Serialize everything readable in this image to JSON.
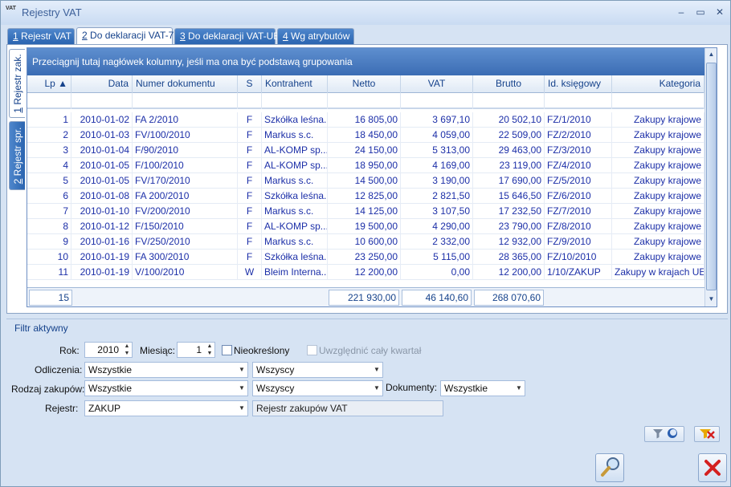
{
  "window": {
    "title": "Rejestry VAT",
    "app_icon_text": "VAT",
    "minimize": "–",
    "maximize": "▭",
    "close": "✕"
  },
  "tabs": [
    {
      "key": "1",
      "label": " Rejestr VAT"
    },
    {
      "key": "2",
      "label": " Do deklaracji VAT-7"
    },
    {
      "key": "3",
      "label": " Do deklaracji VAT-UE"
    },
    {
      "key": "4",
      "label": " Wg atrybutów"
    }
  ],
  "side_tabs": [
    {
      "key": "1",
      "label": " Rejestr zak."
    },
    {
      "key": "2",
      "label": " Rejestr spr."
    }
  ],
  "grid": {
    "group_hint": "Przeciągnij tutaj nagłówek kolumny, jeśli ma ona być podstawą grupowania",
    "columns": [
      "Lp ▲",
      "Data",
      "Numer dokumentu",
      "S",
      "Kontrahent",
      "Netto",
      "VAT",
      "Brutto",
      "Id. księgowy",
      "Kategoria"
    ],
    "rows": [
      [
        "1",
        "2010-01-02",
        "FA 2/2010",
        "F",
        "Szkółka leśna...",
        "16 805,00",
        "3 697,10",
        "20 502,10",
        "FZ/1/2010",
        "Zakupy krajowe"
      ],
      [
        "2",
        "2010-01-03",
        "FV/100/2010",
        "F",
        "Markus s.c.",
        "18 450,00",
        "4 059,00",
        "22 509,00",
        "FZ/2/2010",
        "Zakupy krajowe"
      ],
      [
        "3",
        "2010-01-04",
        "F/90/2010",
        "F",
        "AL-KOMP sp....",
        "24 150,00",
        "5 313,00",
        "29 463,00",
        "FZ/3/2010",
        "Zakupy krajowe"
      ],
      [
        "4",
        "2010-01-05",
        "F/100/2010",
        "F",
        "AL-KOMP sp....",
        "18 950,00",
        "4 169,00",
        "23 119,00",
        "FZ/4/2010",
        "Zakupy krajowe"
      ],
      [
        "5",
        "2010-01-05",
        "FV/170/2010",
        "F",
        "Markus s.c.",
        "14 500,00",
        "3 190,00",
        "17 690,00",
        "FZ/5/2010",
        "Zakupy krajowe"
      ],
      [
        "6",
        "2010-01-08",
        "FA 200/2010",
        "F",
        "Szkółka leśna...",
        "12 825,00",
        "2 821,50",
        "15 646,50",
        "FZ/6/2010",
        "Zakupy krajowe"
      ],
      [
        "7",
        "2010-01-10",
        "FV/200/2010",
        "F",
        "Markus s.c.",
        "14 125,00",
        "3 107,50",
        "17 232,50",
        "FZ/7/2010",
        "Zakupy krajowe"
      ],
      [
        "8",
        "2010-01-12",
        "F/150/2010",
        "F",
        "AL-KOMP sp....",
        "19 500,00",
        "4 290,00",
        "23 790,00",
        "FZ/8/2010",
        "Zakupy krajowe"
      ],
      [
        "9",
        "2010-01-16",
        "FV/250/2010",
        "F",
        "Markus s.c.",
        "10 600,00",
        "2 332,00",
        "12 932,00",
        "FZ/9/2010",
        "Zakupy krajowe"
      ],
      [
        "10",
        "2010-01-19",
        "FA 300/2010",
        "F",
        "Szkółka leśna...",
        "23 250,00",
        "5 115,00",
        "28 365,00",
        "FZ/10/2010",
        "Zakupy krajowe"
      ],
      [
        "11",
        "2010-01-19",
        "V/100/2010",
        "W",
        "Bleim Interna...",
        "12 200,00",
        "0,00",
        "12 200,00",
        "1/10/ZAKUP",
        "Zakupy w krajach UE"
      ]
    ],
    "totals": {
      "count": "15",
      "netto": "221 930,00",
      "vat": "46 140,60",
      "brutto": "268 070,60"
    }
  },
  "filter": {
    "title": "Filtr aktywny",
    "rok_label": "Rok:",
    "rok_value": "2010",
    "miesiac_label": "Miesiąc:",
    "miesiac_value": "1",
    "nieokreslony_label": "Nieokreślony",
    "kwartal_label": "Uwzględnić cały kwartał",
    "odliczenia_label": "Odliczenia:",
    "odliczenia_value": "Wszystkie",
    "odliczenia2_value": "Wszyscy",
    "rodzaj_label": "Rodzaj zakupów:",
    "rodzaj_value": "Wszystkie",
    "rodzaj2_value": "Wszyscy",
    "dokumenty_label": "Dokumenty:",
    "dokumenty_value": "Wszystkie",
    "rejestr_label": "Rejestr:",
    "rejestr_value": "ZAKUP",
    "rejestr_desc": "Rejestr zakupów VAT"
  },
  "icons": {
    "filter": "funnel-icon",
    "clear": "clear-filter-icon",
    "preview": "magnifier-icon",
    "close": "close-icon"
  },
  "colors": {
    "accent": "#2a64b0",
    "cell_text": "#1c2fa8",
    "close_red": "#d42020"
  }
}
